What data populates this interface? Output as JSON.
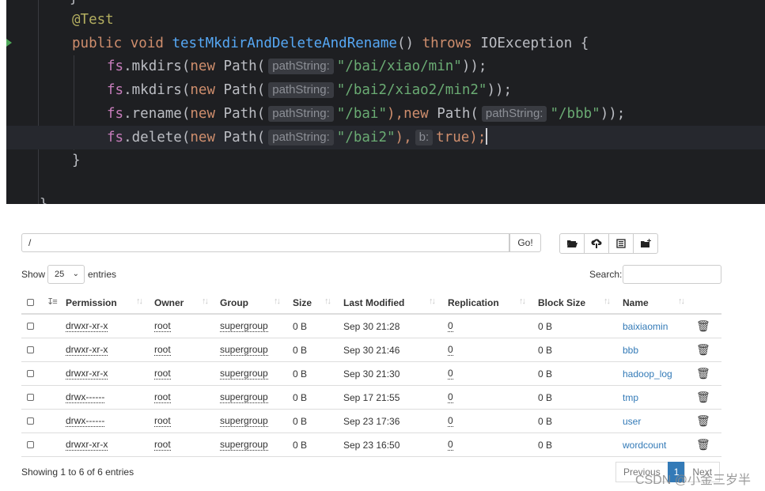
{
  "editor": {
    "annotation": "@Test",
    "sig_public": "public",
    "sig_void": "void",
    "method_name": "testMkdirAndDeleteAndRename",
    "sig_parens": "()",
    "sig_throws": "throws",
    "sig_exception": "IOException {",
    "obj": "fs",
    "dot": ".",
    "kw_new": "new",
    "path_class": "Path(",
    "hint_path": "pathString:",
    "hint_b": "b:",
    "lines": [
      {
        "method": "mkdirs",
        "arg": "\"/bai/xiao/min\"",
        "tail": "));"
      },
      {
        "method": "mkdirs",
        "arg": "\"/bai2/xiao2/min2\"",
        "tail": "));"
      },
      {
        "method": "rename",
        "arg": "\"/bai\"",
        "mid": "),",
        "arg2": "\"/bbb\"",
        "tail": "));"
      },
      {
        "method": "delete",
        "arg": "\"/bai2\"",
        "mid": "),",
        "bool": "true",
        "tail": ");"
      }
    ],
    "closing_brace": "}"
  },
  "browser": {
    "path_value": "/",
    "go_label": "Go!",
    "toolbar_icons": [
      "folder-open-icon",
      "cloud-upload-icon",
      "list-icon",
      "new-folder-icon"
    ],
    "show_label": "Show",
    "page_length": "25",
    "entries_label": "entries",
    "search_label": "Search:",
    "columns": [
      "Permission",
      "Owner",
      "Group",
      "Size",
      "Last Modified",
      "Replication",
      "Block Size",
      "Name"
    ],
    "rows": [
      {
        "permission": "drwxr-xr-x",
        "owner": "root",
        "group": "supergroup",
        "size": "0 B",
        "modified": "Sep 30 21:28",
        "replication": "0",
        "block_size": "0 B",
        "name": "baixiaomin"
      },
      {
        "permission": "drwxr-xr-x",
        "owner": "root",
        "group": "supergroup",
        "size": "0 B",
        "modified": "Sep 30 21:46",
        "replication": "0",
        "block_size": "0 B",
        "name": "bbb"
      },
      {
        "permission": "drwxr-xr-x",
        "owner": "root",
        "group": "supergroup",
        "size": "0 B",
        "modified": "Sep 30 21:30",
        "replication": "0",
        "block_size": "0 B",
        "name": "hadoop_log"
      },
      {
        "permission": "drwx------",
        "owner": "root",
        "group": "supergroup",
        "size": "0 B",
        "modified": "Sep 17 21:55",
        "replication": "0",
        "block_size": "0 B",
        "name": "tmp"
      },
      {
        "permission": "drwx------",
        "owner": "root",
        "group": "supergroup",
        "size": "0 B",
        "modified": "Sep 23 17:36",
        "replication": "0",
        "block_size": "0 B",
        "name": "user"
      },
      {
        "permission": "drwxr-xr-x",
        "owner": "root",
        "group": "supergroup",
        "size": "0 B",
        "modified": "Sep 23 16:50",
        "replication": "0",
        "block_size": "0 B",
        "name": "wordcount"
      }
    ],
    "info_text": "Showing 1 to 6 of 6 entries",
    "pager": {
      "previous": "Previous",
      "current": "1",
      "next": "Next"
    },
    "watermark": "CSDN @小金三岁半"
  }
}
